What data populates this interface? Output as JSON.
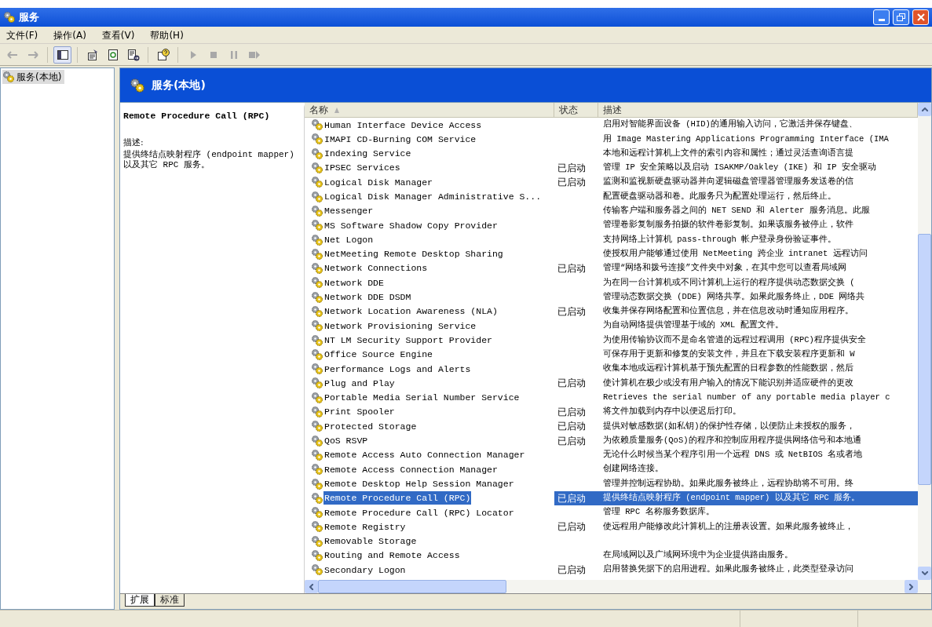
{
  "window": {
    "title": "服务"
  },
  "menu": [
    "文件(F)",
    "操作(A)",
    "查看(V)",
    "帮助(H)"
  ],
  "toolbar": [
    {
      "kind": "back",
      "disabled": true,
      "on": false
    },
    {
      "kind": "forward",
      "disabled": true,
      "on": false
    },
    {
      "kind": "tree",
      "disabled": false,
      "on": true
    },
    {
      "kind": "properties",
      "disabled": false,
      "on": false
    },
    {
      "kind": "refresh",
      "disabled": false,
      "on": false
    },
    {
      "kind": "export",
      "disabled": false,
      "on": false
    },
    {
      "kind": "help",
      "disabled": false,
      "on": false
    },
    {
      "kind": "start",
      "disabled": true,
      "on": false
    },
    {
      "kind": "stop",
      "disabled": true,
      "on": false
    },
    {
      "kind": "pause",
      "disabled": true,
      "on": false
    },
    {
      "kind": "restart",
      "disabled": true,
      "on": false
    }
  ],
  "tree": [
    {
      "label": "服务(本地)",
      "selected": true
    }
  ],
  "panel_title": "服务(本地)",
  "detail": {
    "name": "Remote Procedure Call (RPC)",
    "description_label": "描述:",
    "description": "提供终结点映射程序 (endpoint mapper) 以及其它 RPC 服务。"
  },
  "table": {
    "columns": [
      {
        "label": "名称",
        "sorted": true
      },
      {
        "label": "状态",
        "sorted": false
      },
      {
        "label": "描述",
        "sorted": false
      }
    ],
    "rows": [
      {
        "name": "Human Interface Device Access",
        "description": "启用对智能界面设备 (HID)的通用输入访问，它激活并保存键盘、",
        "selected": false
      },
      {
        "name": "IMAPI CD-Burning COM Service",
        "description": "用 Image Mastering Applications Programming Interface (IMA",
        "selected": false
      },
      {
        "name": "Indexing Service",
        "description": "本地和远程计算机上文件的索引内容和属性；通过灵活查询语言提",
        "selected": false
      },
      {
        "name": "IPSEC Services",
        "status": "已启动",
        "description": "管理 IP 安全策略以及启动 ISAKMP/Oakley (IKE) 和 IP 安全驱动",
        "selected": false
      },
      {
        "name": "Logical Disk Manager",
        "status": "已启动",
        "description": "监测和监视新硬盘驱动器并向逻辑磁盘管理器管理服务发送卷的信",
        "selected": false
      },
      {
        "name": "Logical Disk Manager Administrative S...",
        "description": "配置硬盘驱动器和卷。此服务只为配置处理运行，然后终止。",
        "selected": false
      },
      {
        "name": "Messenger",
        "description": "传输客户端和服务器之间的 NET SEND 和 Alerter 服务消息。此服",
        "selected": false
      },
      {
        "name": "MS Software Shadow Copy Provider",
        "description": "管理卷影复制服务拍摄的软件卷影复制。如果该服务被停止，软件",
        "selected": false
      },
      {
        "name": "Net Logon",
        "description": "支持网络上计算机 pass-through 帐户登录身份验证事件。",
        "selected": false
      },
      {
        "name": "NetMeeting Remote Desktop Sharing",
        "description": "使授权用户能够通过使用 NetMeeting 跨企业 intranet 远程访问",
        "selected": false
      },
      {
        "name": "Network Connections",
        "status": "已启动",
        "description": "管理“网络和拨号连接”文件夹中对象，在其中您可以查看局域网",
        "selected": false
      },
      {
        "name": "Network DDE",
        "description": "为在同一台计算机或不同计算机上运行的程序提供动态数据交换 (",
        "selected": false
      },
      {
        "name": "Network DDE DSDM",
        "description": "管理动态数据交换 (DDE) 网络共享。如果此服务终止，DDE 网络共",
        "selected": false
      },
      {
        "name": "Network Location Awareness (NLA)",
        "status": "已启动",
        "description": "收集并保存网络配置和位置信息，并在信息改动时通知应用程序。",
        "selected": false
      },
      {
        "name": "Network Provisioning Service",
        "description": "为自动网络提供管理基于域的 XML 配置文件。",
        "selected": false
      },
      {
        "name": "NT LM Security Support Provider",
        "description": "为使用传输协议而不是命名管道的远程过程调用 (RPC)程序提供安全",
        "selected": false
      },
      {
        "name": "Office Source Engine",
        "description": "可保存用于更新和修复的安装文件，并且在下载安装程序更新和 W",
        "selected": false
      },
      {
        "name": "Performance Logs and Alerts",
        "description": "收集本地或远程计算机基于预先配置的日程参数的性能数据，然后",
        "selected": false
      },
      {
        "name": "Plug and Play",
        "status": "已启动",
        "description": "使计算机在极少或没有用户输入的情况下能识别并适应硬件的更改",
        "selected": false
      },
      {
        "name": "Portable Media Serial Number Service",
        "description": "Retrieves the serial number of any portable media player c",
        "selected": false
      },
      {
        "name": "Print Spooler",
        "status": "已启动",
        "description": "将文件加载到内存中以便迟后打印。",
        "selected": false
      },
      {
        "name": "Protected Storage",
        "status": "已启动",
        "description": "提供对敏感数据(如私钥)的保护性存储，以便防止未授权的服务，",
        "selected": false
      },
      {
        "name": "QoS RSVP",
        "status": "已启动",
        "description": "为依赖质量服务(QoS)的程序和控制应用程序提供网络信号和本地通",
        "selected": false
      },
      {
        "name": "Remote Access Auto Connection Manager",
        "description": "无论什么时候当某个程序引用一个远程 DNS 或 NetBIOS 名或者地",
        "selected": false
      },
      {
        "name": "Remote Access Connection Manager",
        "description": "创建网络连接。",
        "selected": false
      },
      {
        "name": "Remote Desktop Help Session Manager",
        "description": "管理并控制远程协助。如果此服务被终止，远程协助将不可用。终",
        "selected": false
      },
      {
        "name": "Remote Procedure Call (RPC)",
        "status": "已启动",
        "description": "提供终结点映射程序 (endpoint mapper) 以及其它 RPC 服务。",
        "selected": true
      },
      {
        "name": "Remote Procedure Call (RPC) Locator",
        "description": "管理 RPC 名称服务数据库。",
        "selected": false
      },
      {
        "name": "Remote Registry",
        "status": "已启动",
        "description": "使远程用户能修改此计算机上的注册表设置。如果此服务被终止，",
        "selected": false
      },
      {
        "name": "Removable Storage",
        "selected": false
      },
      {
        "name": "Routing and Remote Access",
        "description": "在局域网以及广域网环境中为企业提供路由服务。",
        "selected": false
      },
      {
        "name": "Secondary Logon",
        "status": "已启动",
        "description": "启用替换凭据下的启用进程。如果此服务被终止，此类型登录访问",
        "selected": false
      }
    ]
  },
  "view_tabs": [
    {
      "label": "扩展",
      "selected": true
    },
    {
      "label": "标准",
      "selected": false
    }
  ]
}
